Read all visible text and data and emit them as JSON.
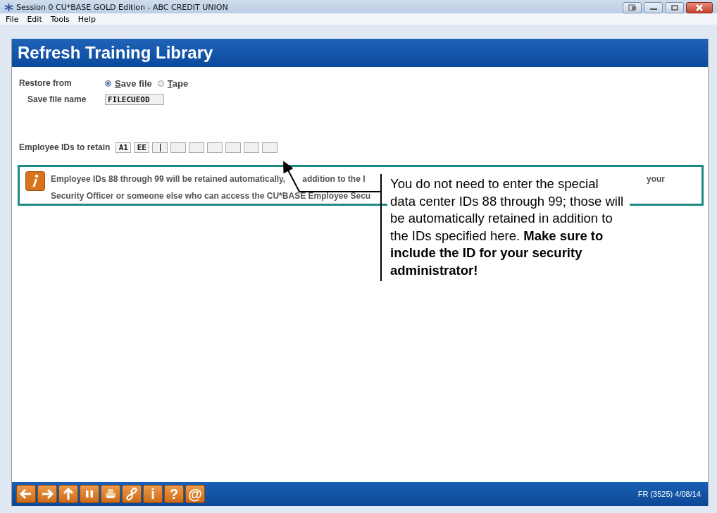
{
  "window": {
    "title": "Session 0 CU*BASE GOLD Edition - ABC CREDIT UNION"
  },
  "menu": [
    "File",
    "Edit",
    "Tools",
    "Help"
  ],
  "heading": "Refresh Training Library",
  "restore": {
    "label": "Restore from",
    "options": [
      {
        "label": "Save file",
        "selected": true
      },
      {
        "label": "Tape",
        "selected": false
      }
    ]
  },
  "save_file": {
    "label": "Save file name",
    "value": "FILECUEOD"
  },
  "employee_ids": {
    "label": "Employee IDs to retain",
    "fields": [
      {
        "value": "A1",
        "focused": false
      },
      {
        "value": "EE",
        "focused": false
      },
      {
        "focused": true
      },
      {
        "focused": false
      },
      {
        "focused": false
      },
      {
        "focused": false
      },
      {
        "focused": false
      },
      {
        "focused": false
      },
      {
        "focused": false
      }
    ]
  },
  "info": {
    "line1_start": "Employee IDs 88 through 99 will be retained automatically,",
    "line1_mid": "addition to the I",
    "line1_end": "your",
    "line2": "Security Officer or someone else who can access the CU*BASE Employee Secu"
  },
  "callout": {
    "text": "You do not need to enter the special data center IDs 88 through 99; those will be automatically retained in addition to the IDs specified here. **Make sure to include the ID for your security administrator!**"
  },
  "toolbar": [
    {
      "kind": "back"
    },
    {
      "kind": "forward"
    },
    {
      "kind": "up"
    },
    {
      "kind": "pause"
    },
    {
      "kind": "print"
    },
    {
      "kind": "link"
    },
    {
      "kind": "text",
      "label": "i"
    },
    {
      "kind": "text",
      "label": "?"
    },
    {
      "kind": "text",
      "label": "@"
    }
  ],
  "status": "FR (3525) 4/08/14"
}
